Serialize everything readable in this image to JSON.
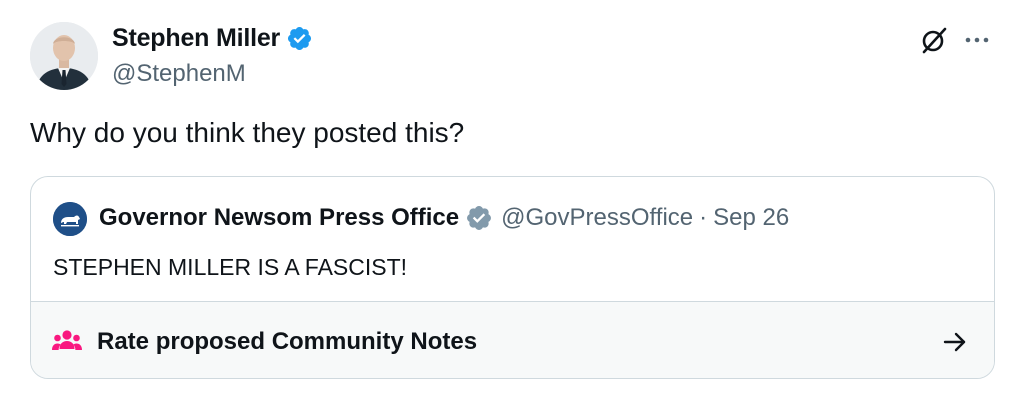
{
  "tweet": {
    "author_name": "Stephen Miller",
    "author_handle": "@StephenM",
    "text": "Why do you think they posted this?",
    "verified_color": "#1d9bf0"
  },
  "quoted_tweet": {
    "author_name": "Governor Newsom Press Office",
    "author_handle": "@GovPressOffice",
    "separator": "·",
    "date": "Sep 26",
    "text": "STEPHEN MILLER IS A FASCIST!",
    "verified_color": "#829aab"
  },
  "community_notes": {
    "label": "Rate proposed Community Notes",
    "icon_color": "#f91880"
  },
  "icons": {
    "author_avatar": "profile-photo",
    "author_verified": "verified-badge-icon",
    "grok": "grok-icon",
    "more": "more-dots-icon",
    "quote_avatar": "california-bear-icon",
    "quote_verified": "gray-verified-badge-icon",
    "notes": "people-group-icon",
    "arrow": "arrow-right-icon"
  }
}
